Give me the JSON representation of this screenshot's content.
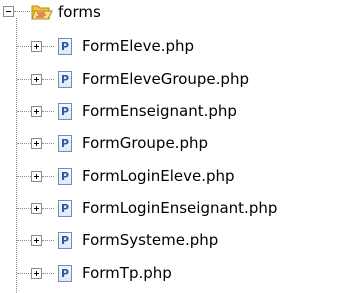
{
  "tree": {
    "root": {
      "label": "forms",
      "icon": "folder-open-icon",
      "expanded": true
    },
    "children": [
      {
        "label": "FormEleve.php",
        "icon": "php-file-icon",
        "icon_glyph": "P"
      },
      {
        "label": "FormEleveGroupe.php",
        "icon": "php-file-icon",
        "icon_glyph": "P"
      },
      {
        "label": "FormEnseignant.php",
        "icon": "php-file-icon",
        "icon_glyph": "P"
      },
      {
        "label": "FormGroupe.php",
        "icon": "php-file-icon",
        "icon_glyph": "P"
      },
      {
        "label": "FormLoginEleve.php",
        "icon": "php-file-icon",
        "icon_glyph": "P"
      },
      {
        "label": "FormLoginEnseignant.php",
        "icon": "php-file-icon",
        "icon_glyph": "P"
      },
      {
        "label": "FormSysteme.php",
        "icon": "php-file-icon",
        "icon_glyph": "P"
      },
      {
        "label": "FormTp.php",
        "icon": "php-file-icon",
        "icon_glyph": "P"
      }
    ]
  },
  "colors": {
    "folder_fill": "#f5c342",
    "folder_stroke": "#b8860b",
    "php_icon_border": "#6e8fb8",
    "php_icon_glyph": "#2a5aa8",
    "tree_lines": "#8a8a8a"
  }
}
